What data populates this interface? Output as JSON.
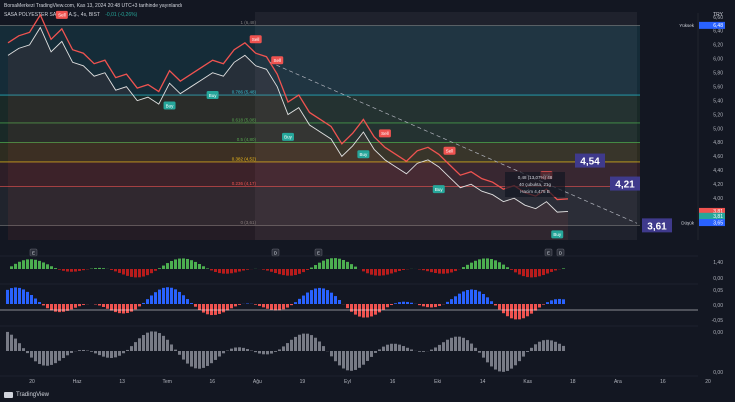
{
  "header": {
    "line1": "BorsaMerkezi TradingView.com, Kas 13, 2024 20:48 UTC+3 tarihinde yayınlandı",
    "line2": "SASA POLYESTER SANAYİ A.Ş., 4s, BIST",
    "change": "-0,01 (-0,26%)"
  },
  "footer": {
    "brand": "TradingView"
  },
  "colors": {
    "bg": "#131722",
    "up": "#26a69a",
    "down": "#ef5350",
    "gold": "#f0c419",
    "fib_cyan": "#26c6da",
    "fib_green": "#4caf50",
    "accent": "#3f3a8c"
  },
  "chart_data": {
    "type": "line",
    "currency": "TRY",
    "x_tick_labels": [
      "20",
      "Haz",
      "13",
      "Tem",
      "16",
      "Ağu",
      "19",
      "Eyl",
      "16",
      "Eki",
      "14",
      "Kas",
      "18",
      "Ara",
      "16",
      "20"
    ],
    "y_ticks": [
      "6,60",
      "6,40",
      "6,20",
      "6,00",
      "5,80",
      "5,60",
      "5,40",
      "5,20",
      "5,00",
      "4,80",
      "4,60",
      "4,40",
      "4,20",
      "4,00"
    ],
    "ylim": [
      3.4,
      6.6
    ],
    "price_series": [
      6.05,
      6.15,
      6.2,
      6.45,
      6.1,
      6.25,
      5.95,
      5.9,
      5.75,
      5.8,
      5.55,
      5.6,
      5.4,
      5.45,
      5.35,
      5.65,
      5.5,
      5.6,
      5.7,
      5.8,
      5.75,
      5.95,
      6.05,
      5.9,
      5.85,
      5.6,
      5.2,
      5.3,
      5.05,
      4.95,
      4.85,
      4.6,
      4.75,
      4.95,
      4.7,
      4.55,
      4.45,
      4.35,
      4.5,
      4.55,
      4.45,
      4.3,
      4.15,
      4.2,
      4.1,
      4.05,
      3.95,
      4.0,
      3.9,
      3.85,
      3.95,
      3.8,
      3.81
    ],
    "fib_levels": [
      {
        "label": "0 (3,61)",
        "value": 3.61,
        "color": "#808080"
      },
      {
        "label": "0.236 (4,17)",
        "value": 4.17,
        "color": "#ef5350"
      },
      {
        "label": "0.382 (4,52)",
        "value": 4.52,
        "color": "#f0c419"
      },
      {
        "label": "0.5 (4,80)",
        "value": 4.8,
        "color": "#4caf50"
      },
      {
        "label": "0.618 (5,08)",
        "value": 5.08,
        "color": "#4caf50"
      },
      {
        "label": "0.786 (5,48)",
        "value": 5.48,
        "color": "#26c6da"
      },
      {
        "label": "1 (6,48)",
        "value": 6.48,
        "color": "#808080"
      }
    ],
    "price_boxes": [
      {
        "label": "4,54",
        "value": 4.54
      },
      {
        "label": "4,21",
        "value": 4.21
      },
      {
        "label": "3,61",
        "value": 3.61
      }
    ],
    "axis_tags": [
      {
        "label": "Yüksek",
        "price": "6,48",
        "value": 6.48,
        "color": "#2962ff"
      },
      {
        "label": "",
        "price": "3,81",
        "value": 3.81,
        "color": "#ef5350"
      },
      {
        "label": "",
        "price": "3,81",
        "value": 3.74,
        "color": "#26a69a"
      },
      {
        "label": "Düşük",
        "price": "3,65",
        "value": 3.65,
        "color": "#2962ff"
      }
    ],
    "signals": [
      {
        "type": "Sell",
        "i": 5
      },
      {
        "type": "Buy",
        "i": 15
      },
      {
        "type": "Buy",
        "i": 19
      },
      {
        "type": "Sell",
        "i": 23
      },
      {
        "type": "Sell",
        "i": 25
      },
      {
        "type": "Buy",
        "i": 26
      },
      {
        "type": "Buy",
        "i": 33
      },
      {
        "type": "Sell",
        "i": 35
      },
      {
        "type": "Buy",
        "i": 40
      },
      {
        "type": "Sell",
        "i": 41
      },
      {
        "type": "Sell",
        "i": 50
      },
      {
        "type": "Buy",
        "i": 51
      }
    ],
    "measure": {
      "line1": "0,48 (13,07%) 48",
      "line2": "40 çubukta, 21g",
      "line3": "Hacim 4,475 B"
    },
    "event_markers": [
      "E",
      "D",
      "E",
      "E",
      "D"
    ],
    "ind1": {
      "ticks": [
        "1,40",
        "0,00"
      ]
    },
    "ind2": {
      "ticks": [
        "0,05",
        "0,00",
        "-0,05"
      ]
    },
    "ind3": {
      "ticks": [
        "0,00",
        "0,00"
      ]
    }
  }
}
